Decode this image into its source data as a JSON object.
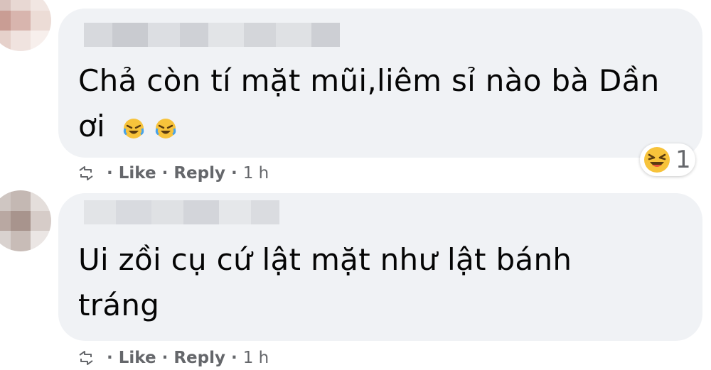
{
  "comments": [
    {
      "text_lines": [
        "Chả còn tí mặt mũi,liêm sỉ nào bà Dần",
        "ơi"
      ],
      "inline_emoji": [
        "rolling-laughing-emoji",
        "rolling-laughing-emoji"
      ],
      "actions": {
        "like": "Like",
        "reply": "Reply",
        "time": "1 h"
      },
      "reaction": {
        "icon": "laughing-face-emoji",
        "count": "1"
      }
    },
    {
      "text_lines": [
        "Ui zồi cụ cứ lật mặt như lật bánh",
        "tráng"
      ],
      "actions": {
        "like": "Like",
        "reply": "Reply",
        "time": "1 h"
      }
    }
  ],
  "separator": "·",
  "colors": {
    "bubble": "#f0f2f5",
    "meta": "#65676b",
    "text": "#050505",
    "emoji": "#f7c33b"
  }
}
